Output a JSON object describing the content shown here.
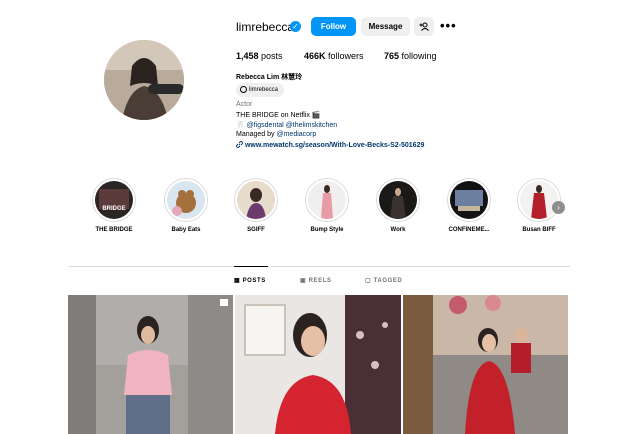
{
  "profile": {
    "username": "limrebecca",
    "verified_icon": "verified-badge-icon",
    "follow_label": "Follow",
    "message_label": "Message",
    "add_user_label": "+R",
    "more_label": "•••"
  },
  "stats": {
    "posts_count": "1,458",
    "posts_label": "posts",
    "followers_count": "466K",
    "followers_label": "followers",
    "following_count": "765",
    "following_label": "following"
  },
  "bio": {
    "full_name": "Rebecca Lim 林慧玲",
    "threads_handle": "limrebecca",
    "category": "Actor",
    "line1": "THE BRIDGE on Netflix 🎬",
    "line2": "🦷 @figsdental @thelimskitchen",
    "line3_prefix": "Managed by ",
    "line3_mention": "@mediacorp",
    "website": "www.mewatch.sg/season/With-Love-Becks-S2-501629"
  },
  "highlights": [
    {
      "label": "THE BRIDGE"
    },
    {
      "label": "Baby Eats"
    },
    {
      "label": "SGIFF"
    },
    {
      "label": "Bump Style"
    },
    {
      "label": "Work"
    },
    {
      "label": "CONFINEME..."
    },
    {
      "label": "Busan BIFF"
    }
  ],
  "highlight_next_icon": "chevron-right-icon",
  "tabs": {
    "posts": "POSTS",
    "reels": "REELS",
    "tagged": "TAGGED"
  },
  "colors": {
    "accent": "#0095f6",
    "link": "#00376b",
    "muted": "#737373"
  }
}
